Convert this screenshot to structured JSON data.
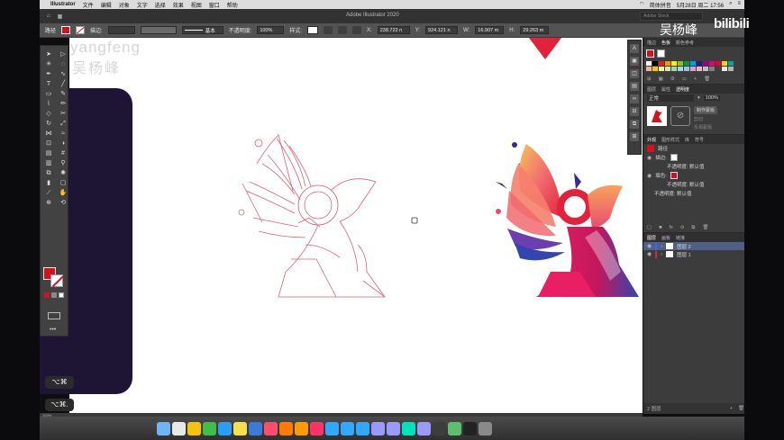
{
  "menubar": {
    "app_name": "Illustrator",
    "menus": [
      "文件",
      "编辑",
      "对象",
      "文字",
      "选择",
      "效果",
      "视图",
      "窗口",
      "帮助"
    ],
    "clock": "5月28日 周二 17:56",
    "input_method": "简体拼音"
  },
  "titlebar": {
    "label": "路径",
    "document_title": "Adobe Illustrator 2020",
    "search_placeholder": "Adobe Stock"
  },
  "control_bar": {
    "stroke_label": "描边:",
    "brush_label": "基本",
    "opacity_label": "不透明度:",
    "opacity_value": "100%",
    "style_label": "样式:",
    "x_value": "238.722 n",
    "y_value": "924.121 n",
    "w_value": "16.907 m",
    "h_value": "29.263 m"
  },
  "watermark": {
    "name_latin": "yangfeng",
    "name_cn": "吴杨峰"
  },
  "overlay": {
    "chip_text": "⌥⌘",
    "chip_text_2": "⌥⌘."
  },
  "tools_panel": {
    "tools": [
      "selection",
      "direct-selection",
      "magic-wand",
      "lasso",
      "pen",
      "curvature",
      "type",
      "line",
      "rectangle",
      "paintbrush",
      "shaper",
      "pencil",
      "eraser",
      "scissors",
      "rotate",
      "scale",
      "width",
      "warp",
      "free-transform",
      "shape-builder",
      "perspective",
      "mesh",
      "gradient",
      "eyedropper",
      "blend",
      "symbol-sprayer",
      "column-graph",
      "artboard",
      "slice",
      "hand",
      "zoom",
      "fill-stroke"
    ]
  },
  "swatches_panel": {
    "tabs": [
      "描边",
      "色板",
      "颜色参考"
    ],
    "active_tab": "色板",
    "colors": [
      "#ffffff",
      "#000000",
      "#e32119",
      "#f39800",
      "#fff100",
      "#8fc31f",
      "#009944",
      "#00a0e9",
      "#1d2088",
      "#920783",
      "#e4007f",
      "#e60033",
      "#ffd400",
      "#00a7a7",
      "#f6adad",
      "#fcc800",
      "#fff799",
      "#d7e7af",
      "#a5d4ad",
      "#a0d8ef",
      "#a3bce2",
      "#cfa7cd",
      "#f4b3c2",
      "#c0c0c0",
      "#808080",
      "#404040",
      "#e8e8e8",
      "#b5b5b5"
    ]
  },
  "transparency_panel": {
    "tabs": [
      "图层",
      "属性",
      "透明度"
    ],
    "active_tab": "透明度",
    "mode": "正常",
    "opacity": "100%",
    "make_mask": "制作蒙版",
    "clip": "剪切",
    "invert": "反相蒙版"
  },
  "appearance_panel": {
    "tabs": [
      "外观",
      "图形样式",
      "库",
      "符号"
    ],
    "active_tab": "外观",
    "object": "路径",
    "rows": [
      {
        "label": "描边:",
        "value": ""
      },
      {
        "label": "不透明度: 默认值",
        "value": ""
      },
      {
        "label": "填色:",
        "value": ""
      },
      {
        "label": "不透明度: 默认值",
        "value": ""
      },
      {
        "label": "不透明度: 默认值",
        "value": ""
      }
    ]
  },
  "layers_panel": {
    "tabs": [
      "图层",
      "画板",
      "链接"
    ],
    "layers": [
      {
        "name": "图层 2",
        "selected": true,
        "color": "#2b6cff"
      },
      {
        "name": "图层 1",
        "selected": false,
        "color": "#e0223a"
      }
    ],
    "count": "2 图层"
  },
  "status_bar": {
    "zoom": "100%"
  },
  "brand": {
    "channel_cn": "吴杨峰",
    "site": "bilibili"
  },
  "dock": {
    "apps": [
      "Finder",
      "Chrome",
      "QQ",
      "WeChat",
      "Safari",
      "Notes",
      "Mail",
      "Music",
      "Ai",
      "Ai",
      "Id",
      "Ps",
      "Ps",
      "Lr",
      "Pr",
      "Ae",
      "Au",
      "Me",
      "Cinema",
      "Maps",
      "Terminal",
      "Trash"
    ]
  }
}
